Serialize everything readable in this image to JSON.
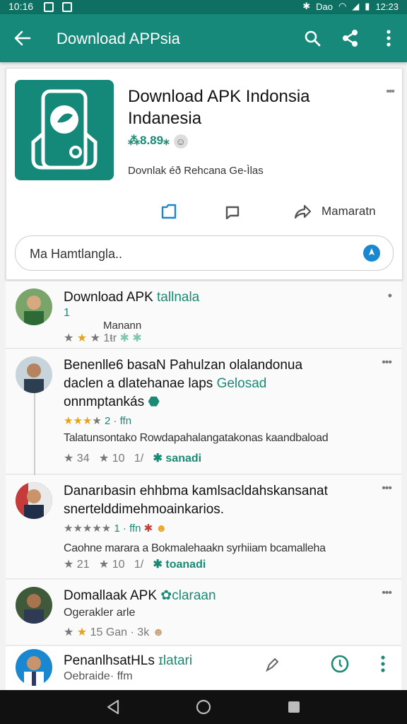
{
  "status": {
    "time_left": "10:16",
    "carrier": "Dao",
    "time_right": "12:23"
  },
  "toolbar": {
    "title": "Download APPsia"
  },
  "app": {
    "name_line1": "Download APK Indonsia",
    "name_line2": "Indanesia",
    "rating": "⁂8.89⁎",
    "description": "Dovnlak éð Rehcana Ge-Ìlas",
    "action_label": "Mamaratn"
  },
  "search": {
    "value": "Ma Hamtlangla.."
  },
  "reviews": [
    {
      "title": "Download APK",
      "title_tag": "tallnala",
      "sub1": "1",
      "sub2": "Manann",
      "meta": "1ŧr"
    },
    {
      "title_line1": "Benenlle6 basaN Pahulzan olalandonua",
      "title_line2a": "daclen a dlatehanae laps ",
      "title_line2b": "Gelosad",
      "title_line3": "onnmptankás",
      "stars_text": "2 · ffn",
      "body": "Talatunsontako Rowdapahalangatakonas kaandbaload",
      "meta_a": "34",
      "meta_b": "10",
      "meta_c": "1/",
      "meta_tag": "sanadi"
    },
    {
      "title_line1": "Danarıbasin ehhbma kamlsacldahskansanat",
      "title_line2": "snertelddimehmoainkarios.",
      "stars_text": "1 · ffn",
      "body": "Caohne marara a Bokmalehaakn syrhiiam bcamalleha",
      "meta_a": "21",
      "meta_b": "10",
      "meta_c": "1/",
      "meta_tag": "toanadi"
    },
    {
      "title": "Domallaak APK",
      "title_tag": "claraan",
      "sub1": "Ogerakler arle",
      "meta": "15  Gan · 3k"
    },
    {
      "title": "PenanlhsatHLs",
      "title_tag": "ɪlatari",
      "sub1": "Oebraide· ffm"
    }
  ],
  "colors": {
    "primary": "#17897a",
    "status": "#0e6f63",
    "accent": "#1b8a74",
    "star": "#e8a21a"
  }
}
